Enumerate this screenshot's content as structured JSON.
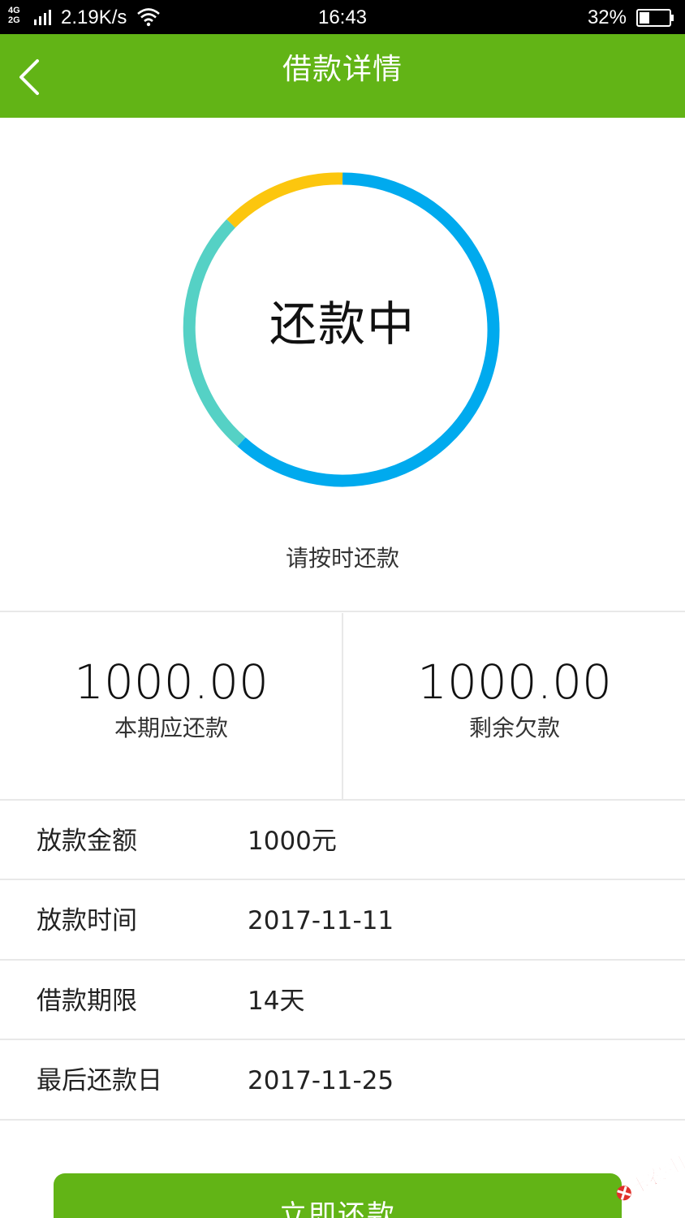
{
  "status_bar": {
    "network_type_top": "4G",
    "network_type_bottom": "2G",
    "net_speed": "2.19K/s",
    "time": "16:43",
    "battery": "32%"
  },
  "header": {
    "title": "借款详情",
    "back_icon": "chevron-left-icon",
    "color": "#62b416"
  },
  "status_ring": {
    "status_text": "还款中",
    "segment_colors": [
      "#00aaee",
      "#55d1c5",
      "#fcc60e"
    ],
    "reminder": "请按时还款"
  },
  "amounts": [
    {
      "value": "1000.00",
      "label": "本期应还款"
    },
    {
      "value": "1000.00",
      "label": "剩余欠款"
    }
  ],
  "details": [
    {
      "label": "放款金额",
      "value": "1000元"
    },
    {
      "label": "放款时间",
      "value": "2017-11-11"
    },
    {
      "label": "借款期限",
      "value": "14天"
    },
    {
      "label": "最后还款日",
      "value": "2017-11-25"
    }
  ],
  "action": {
    "repay_label": "立即还款"
  },
  "watermark": {
    "text": "卡农社区"
  }
}
